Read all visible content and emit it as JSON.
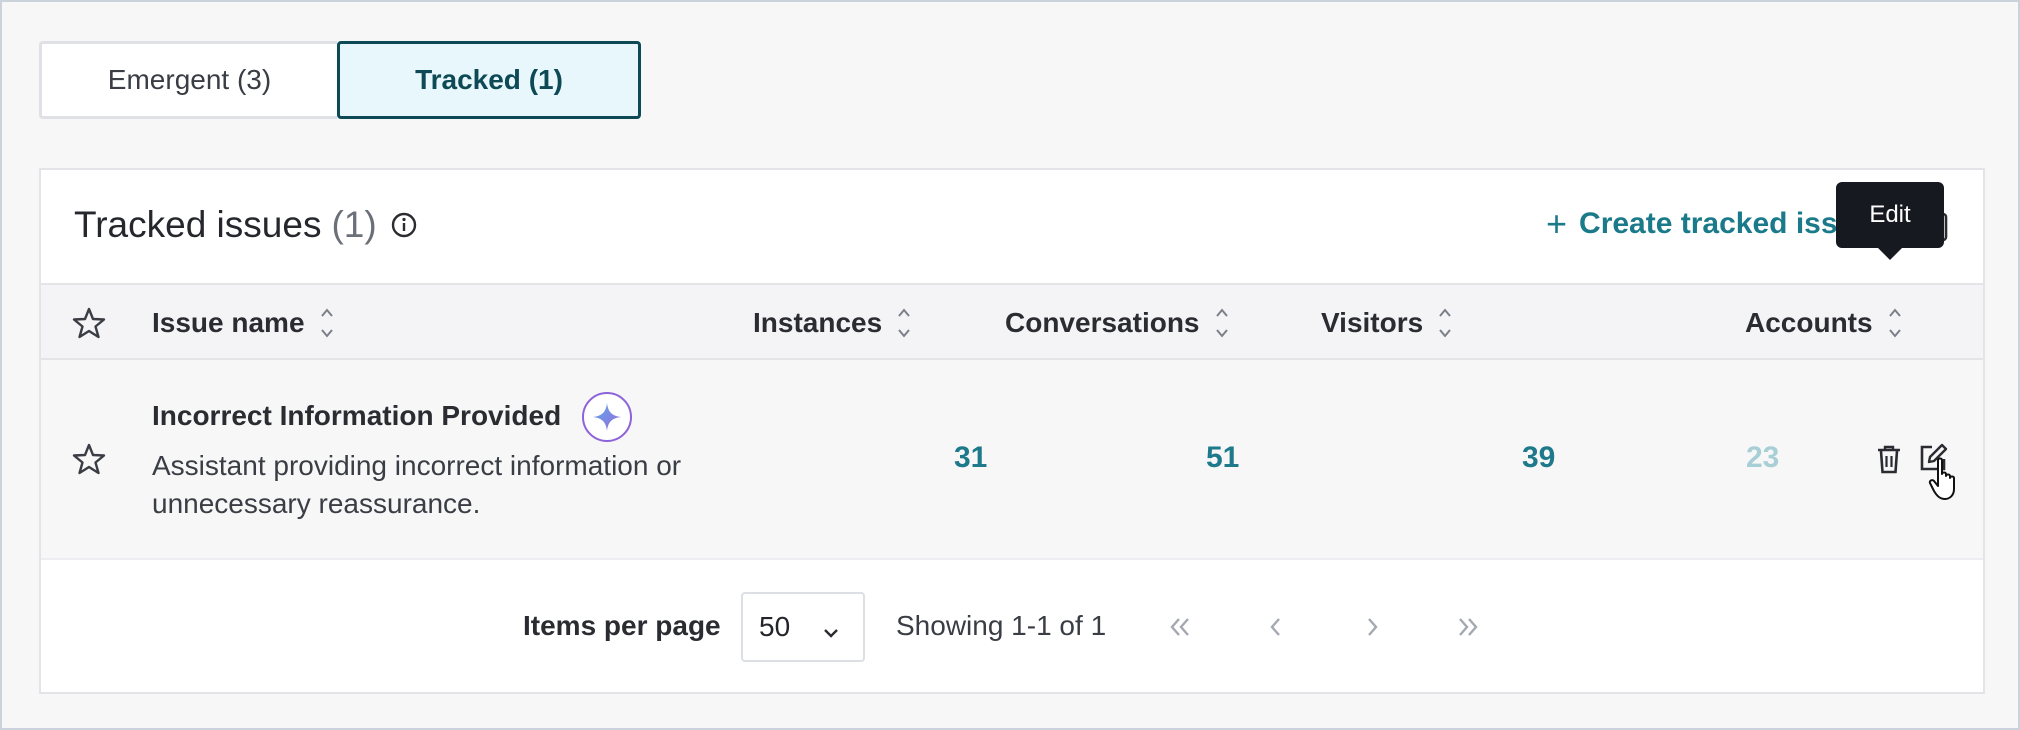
{
  "tabs": [
    {
      "label": "Emergent (3)"
    },
    {
      "label": "Tracked (1)"
    }
  ],
  "header": {
    "title": "Tracked issues",
    "count": "(1)",
    "create_label": "Create tracked issue",
    "create_icon": "plus-icon"
  },
  "columns": [
    {
      "label": "Issue name"
    },
    {
      "label": "Instances"
    },
    {
      "label": "Conversations"
    },
    {
      "label": "Visitors"
    },
    {
      "label": "Accounts"
    }
  ],
  "rows": [
    {
      "name": "Incorrect Information Provided",
      "description": "Assistant providing incorrect information or unnecessary reassurance.",
      "instances": "31",
      "conversations": "51",
      "visitors": "39",
      "accounts": "23"
    }
  ],
  "tooltip": {
    "text": "Edit"
  },
  "pagination": {
    "items_per_page_label": "Items per page",
    "items_per_page_value": "50",
    "showing": "Showing 1-1 of 1"
  },
  "colors": {
    "accent": "#1e7a8a",
    "tab_active_border": "#0d4a55",
    "tab_active_bg": "#e8f7fb",
    "ai_badge": "#8d63d9"
  }
}
